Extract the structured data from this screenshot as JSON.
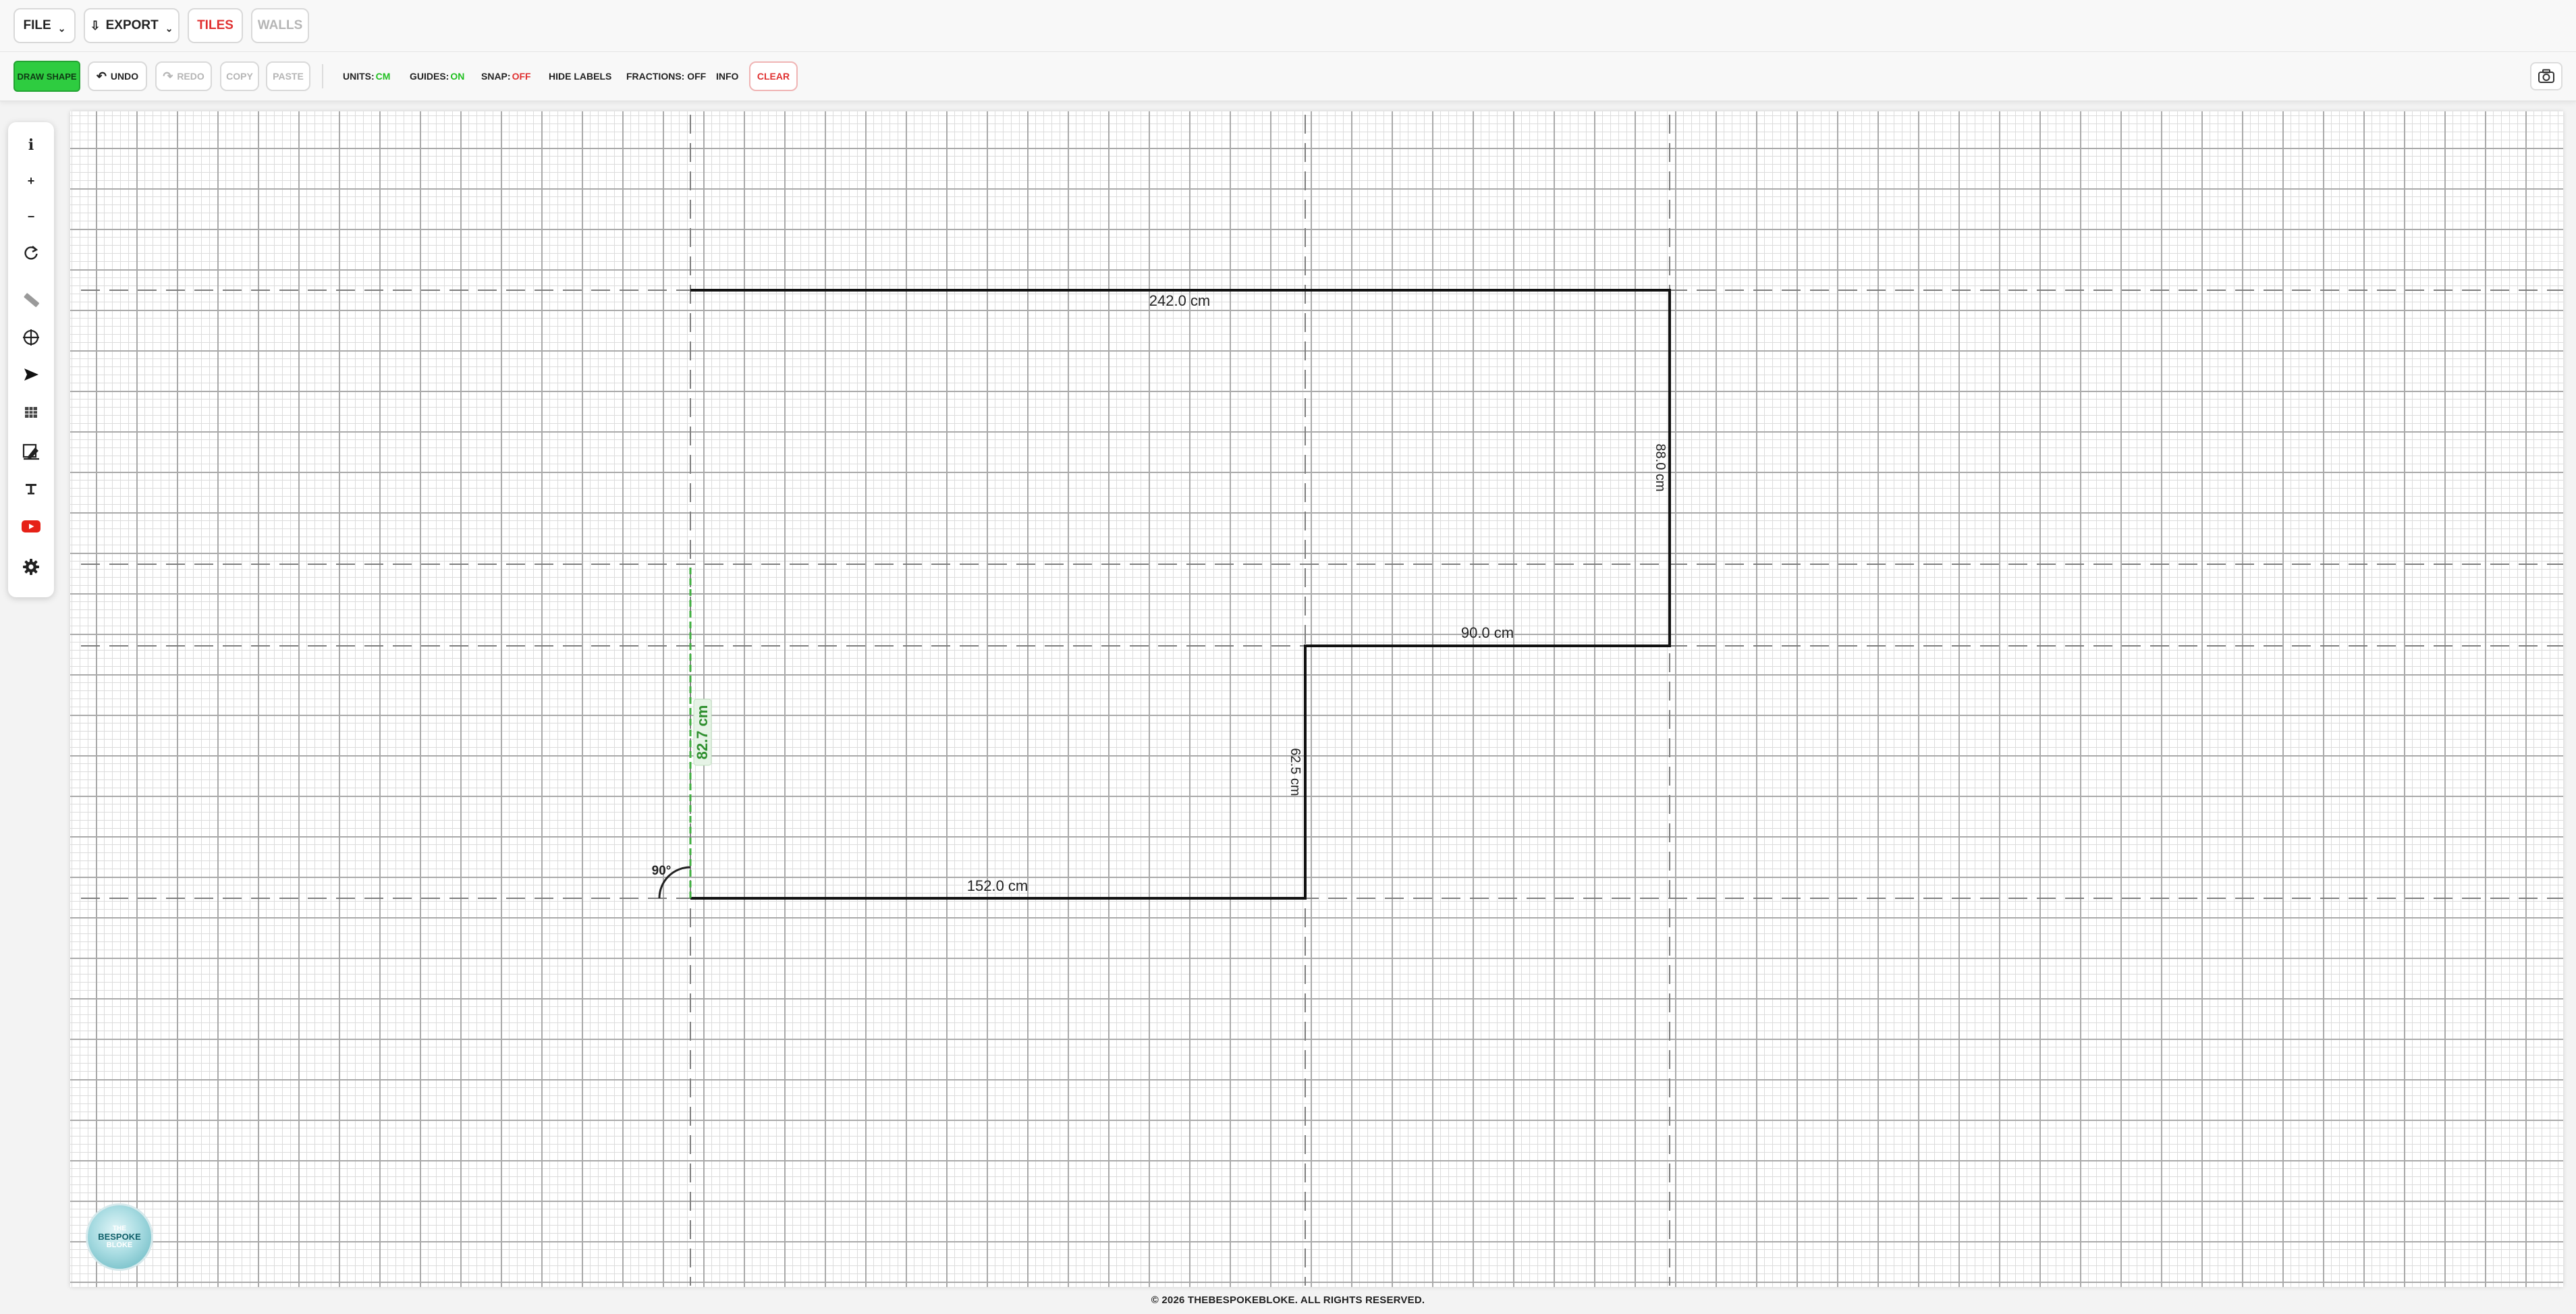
{
  "topbar": {
    "file_label": "FILE",
    "export_label": "EXPORT",
    "tiles_label": "TILES",
    "walls_label": "WALLS"
  },
  "toolbar": {
    "draw_shape": "DRAW SHAPE",
    "undo": "UNDO",
    "redo": "REDO",
    "copy": "COPY",
    "paste": "PASTE",
    "units_label": "UNITS:",
    "units_value": "CM",
    "guides_label": "GUIDES:",
    "guides_value": "ON",
    "snap_label": "SNAP:",
    "snap_value": "OFF",
    "hide_labels": "HIDE LABELS",
    "fractions": "FRACTIONS: OFF",
    "info": "INFO",
    "clear": "CLEAR"
  },
  "sidebar": {
    "tools": [
      "info-icon",
      "zoom-in-icon",
      "zoom-out-icon",
      "reset-icon",
      "ruler-icon",
      "crosshair-icon",
      "pointer-icon",
      "grid-icon",
      "paint-icon",
      "text-icon",
      "youtube-icon",
      "settings-icon"
    ],
    "info_glyph": "i",
    "zoom_in_glyph": "+",
    "zoom_out_glyph": "−"
  },
  "drawing": {
    "labels": {
      "top": "242.0 cm",
      "right": "88.0 cm",
      "step_horizontal": "90.0 cm",
      "step_vertical": "62.5 cm",
      "bottom": "152.0 cm",
      "preview": "82.7 cm",
      "angle": "90°"
    }
  },
  "logo": {
    "line1": "THE",
    "line2": "BESPOKE",
    "line3": "BLOKE"
  },
  "footer": {
    "copyright": "© 2026 THEBESPOKEBLOKE. ALL RIGHTS RESERVED."
  },
  "colors": {
    "accent_green": "#2ecc40",
    "status_on": "#1fbf1f",
    "status_off": "#e03030",
    "guide_preview": "#3fae3f",
    "wall_line": "#111111"
  }
}
